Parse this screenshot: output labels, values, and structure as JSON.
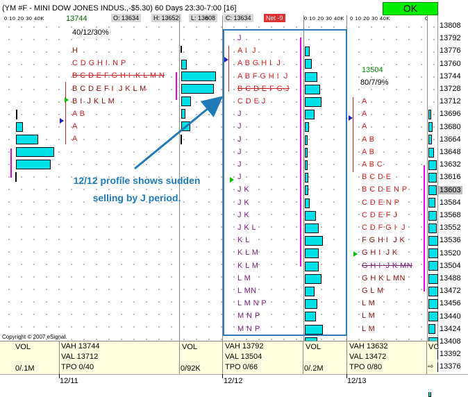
{
  "window": {
    "title": "(YM #F - MINI DOW JONES INDUS.,-$5.30) 60 Days 23:30-7:00 [16]",
    "ok_label": "OK"
  },
  "quote_bar": {
    "last": "13744",
    "open": "O: 13634",
    "high": "H: 13652",
    "low": "L: 13608",
    "close": "C: 13634",
    "net": "Net -9"
  },
  "scale_ticks": [
    "0   10  20  30  40K",
    "0",
    "0   10  20  30  40K",
    "0   10  20  30  40K",
    "0"
  ],
  "price_axis": [
    "13808",
    "13792",
    "13776",
    "13760",
    "13744",
    "13728",
    "13712",
    "13696",
    "13680",
    "13664",
    "13648",
    "13632",
    "13616",
    "13603",
    "13584",
    "13568",
    "13552",
    "13536",
    "13520",
    "13504",
    "13488",
    "13472",
    "13456",
    "13440",
    "13424",
    "13408",
    "13392",
    "13376"
  ],
  "day1": {
    "stats_line": "40/12/30%",
    "tpo": [
      {
        "text": "H",
        "style": "dred"
      },
      {
        "text": "C D G H I  N P",
        "style": "red"
      },
      {
        "text": "B C D E F G H I  K L M N",
        "style": "red strike"
      },
      {
        "text": "B C D E F I  J K L M",
        "style": "dred"
      },
      {
        "text": "B I  J K L M",
        "style": "dred"
      },
      {
        "text": "A B",
        "style": "red"
      },
      {
        "text": "A",
        "style": "red"
      },
      {
        "text": "A",
        "style": "red"
      }
    ]
  },
  "day2": {
    "tpo": [
      {
        "text": "J",
        "style": "purple"
      },
      {
        "text": "A I  J",
        "style": "red"
      },
      {
        "text": "A B G H I  J",
        "style": "red"
      },
      {
        "text": "A B F G H I  J",
        "style": "red"
      },
      {
        "text": "B C D E F G J",
        "style": "red strike"
      },
      {
        "text": "C D E J",
        "style": "red"
      },
      {
        "text": "J",
        "style": "purple"
      },
      {
        "text": "J",
        "style": "purple"
      },
      {
        "text": "J",
        "style": "purple"
      },
      {
        "text": "J",
        "style": "purple"
      },
      {
        "text": "J",
        "style": "purple"
      },
      {
        "text": "J",
        "style": "purple"
      },
      {
        "text": "J K",
        "style": "purple"
      },
      {
        "text": "J K",
        "style": "purple"
      },
      {
        "text": "J K",
        "style": "purple"
      },
      {
        "text": "J K L",
        "style": "purple"
      },
      {
        "text": "K L",
        "style": "purple"
      },
      {
        "text": "K L M",
        "style": "purple"
      },
      {
        "text": "K L M",
        "style": "purple"
      },
      {
        "text": "L M",
        "style": "purple"
      },
      {
        "text": "L MN",
        "style": "purple"
      },
      {
        "text": "L M N P",
        "style": "purple"
      },
      {
        "text": "M N P",
        "style": "purple"
      },
      {
        "text": "M N P",
        "style": "purple"
      }
    ]
  },
  "day3": {
    "last_value": "13504",
    "stats_line": "80/7/9%",
    "tpo": [
      {
        "text": "A",
        "style": "red"
      },
      {
        "text": "A",
        "style": "red"
      },
      {
        "text": "A",
        "style": "red"
      },
      {
        "text": "A B",
        "style": "red"
      },
      {
        "text": "A B",
        "style": "red"
      },
      {
        "text": "A B C",
        "style": "red"
      },
      {
        "text": "B C D E",
        "style": "red"
      },
      {
        "text": "B C D E N P",
        "style": "red"
      },
      {
        "text": "C D E N P",
        "style": "red"
      },
      {
        "text": "C D E F J",
        "style": "red"
      },
      {
        "text": "C D F G I  J",
        "style": "red"
      },
      {
        "text": "F G H I  J K",
        "style": "dred"
      },
      {
        "text": "G H I  J K",
        "style": "dred"
      },
      {
        "text": "G H I  J K MN",
        "style": "purple strike"
      },
      {
        "text": "G H K L MN",
        "style": "dred"
      },
      {
        "text": "G L M",
        "style": "dred"
      },
      {
        "text": "L M",
        "style": "dred"
      },
      {
        "text": "L M",
        "style": "dred"
      },
      {
        "text": "L M",
        "style": "dred"
      }
    ]
  },
  "annotation": {
    "line1": "12/12 profile shows sudden",
    "line2": "selling by J period."
  },
  "copyright": "Copyright © 2007 eSignal.",
  "bottom": {
    "d1_vol_label": "VOL",
    "d1_vol": "0/.1M",
    "d1_vah": "VAH 13744",
    "d1_val": "VAL  13712",
    "d1_tpo": "TPO 0/40",
    "d1_vol2_label": "VOL",
    "d1_vol2": "0/92K",
    "d2_vah": "VAH 13792",
    "d2_val": "VAL  13504",
    "d2_tpo": "TPO 0/66",
    "d2_vol_label": "VOL",
    "d2_vol": "0/.2M",
    "d3_vah": "VAH 13632",
    "d3_val": "VAL  13472",
    "d3_tpo": "TPO 0/80",
    "d3_vol_label": "VC"
  },
  "dates": [
    "12/11",
    "12/12",
    "12/13"
  ],
  "colors": {
    "accent": "#1f7ab8",
    "volume_bar": "#00e0e8",
    "tpo_red": "#d02020",
    "tpo_purple": "#7a1c7a",
    "ok_green": "#00ee00"
  }
}
